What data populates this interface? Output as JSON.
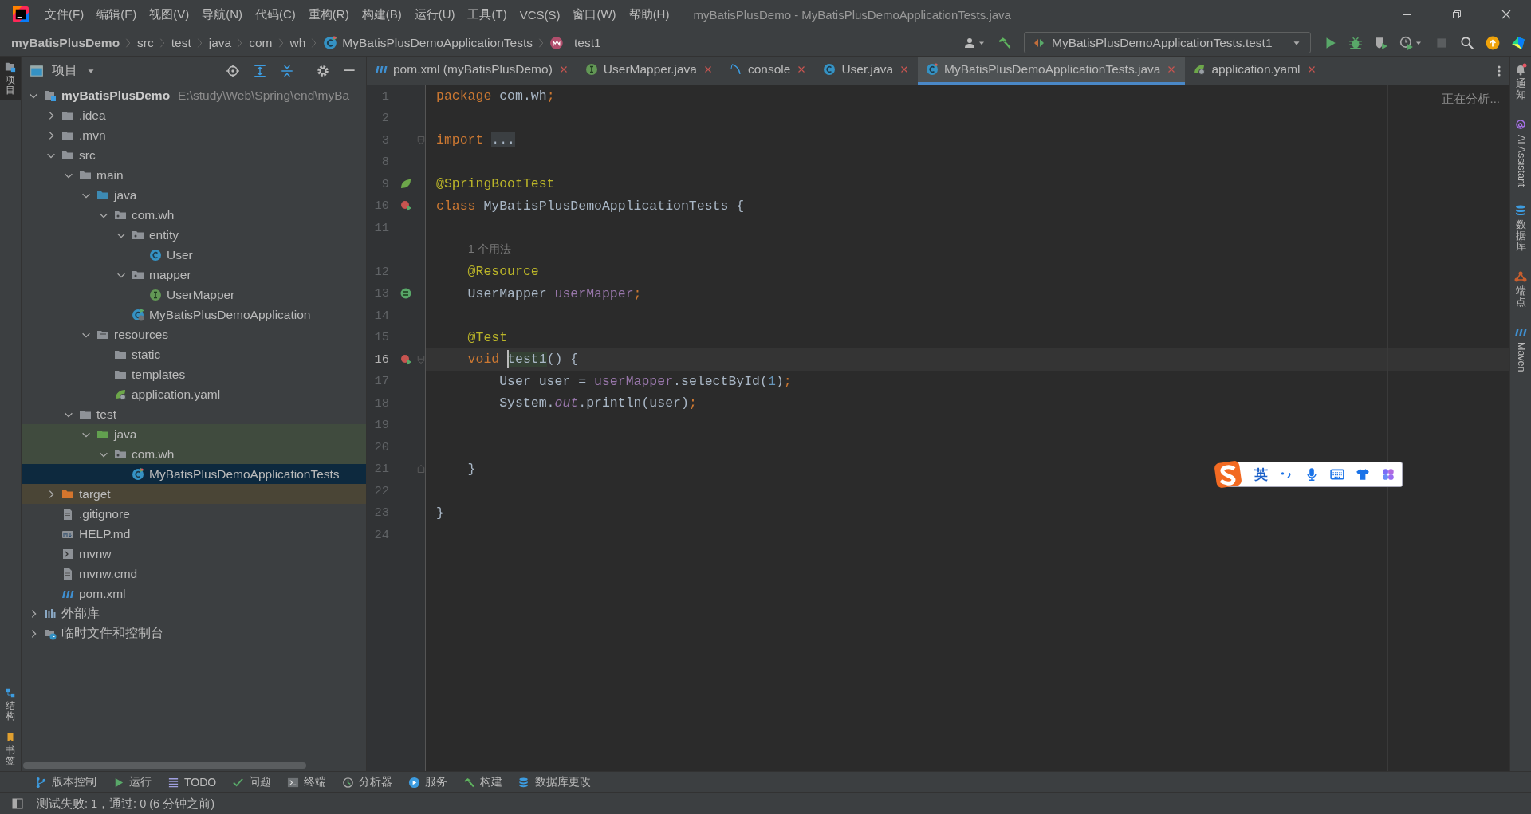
{
  "window": {
    "title": "myBatisPlusDemo - MyBatisPlusDemoApplicationTests.java"
  },
  "menu": [
    "文件(F)",
    "编辑(E)",
    "视图(V)",
    "导航(N)",
    "代码(C)",
    "重构(R)",
    "构建(B)",
    "运行(U)",
    "工具(T)",
    "VCS(S)",
    "窗口(W)",
    "帮助(H)"
  ],
  "breadcrumbs": [
    {
      "label": "myBatisPlusDemo",
      "kind": "project"
    },
    {
      "label": "src",
      "kind": "plain"
    },
    {
      "label": "test",
      "kind": "plain"
    },
    {
      "label": "java",
      "kind": "plain"
    },
    {
      "label": "com",
      "kind": "plain"
    },
    {
      "label": "wh",
      "kind": "plain"
    },
    {
      "label": "MyBatisPlusDemoApplicationTests",
      "kind": "test_class"
    },
    {
      "label": "test1",
      "kind": "method"
    }
  ],
  "run_config": {
    "label": "MyBatisPlusDemoApplicationTests.test1",
    "stop_disabled": true
  },
  "left_stripe": {
    "top": [
      {
        "label": "项目",
        "kind": "project",
        "selected": true
      }
    ],
    "bottom": [
      {
        "label": "结构",
        "kind": "structure",
        "selected": false
      },
      {
        "label": "书签",
        "kind": "bookmark",
        "selected": false
      }
    ]
  },
  "project_panel": {
    "title": "项目"
  },
  "tree": [
    {
      "label": "myBatisPlusDemo",
      "kind": "project",
      "hint": "E:\\study\\Web\\Spring\\end\\myBa",
      "expanded": true,
      "selected": false,
      "children": [
        {
          "label": ".idea",
          "kind": "folder",
          "expanded": false,
          "selected": false
        },
        {
          "label": ".mvn",
          "kind": "folder",
          "expanded": false,
          "selected": false
        },
        {
          "label": "src",
          "kind": "folder",
          "expanded": true,
          "selected": false,
          "children": [
            {
              "label": "main",
              "kind": "folder",
              "expanded": true,
              "selected": false,
              "children": [
                {
                  "label": "java",
                  "kind": "source_folder",
                  "expanded": true,
                  "selected": false,
                  "children": [
                    {
                      "label": "com.wh",
                      "kind": "package",
                      "expanded": true,
                      "selected": false,
                      "children": [
                        {
                          "label": "entity",
                          "kind": "package",
                          "expanded": true,
                          "selected": false,
                          "children": [
                            {
                              "label": "User",
                              "kind": "class",
                              "selected": false
                            }
                          ]
                        },
                        {
                          "label": "mapper",
                          "kind": "package",
                          "expanded": true,
                          "selected": false,
                          "children": [
                            {
                              "label": "UserMapper",
                              "kind": "interface",
                              "selected": false
                            }
                          ]
                        },
                        {
                          "label": "MyBatisPlusDemoApplication",
                          "kind": "spring_app",
                          "selected": false
                        }
                      ]
                    }
                  ]
                },
                {
                  "label": "resources",
                  "kind": "resources_folder",
                  "expanded": true,
                  "selected": false,
                  "children": [
                    {
                      "label": "static",
                      "kind": "folder",
                      "selected": false
                    },
                    {
                      "label": "templates",
                      "kind": "folder",
                      "selected": false
                    },
                    {
                      "label": "application.yaml",
                      "kind": "yaml",
                      "selected": false
                    }
                  ]
                }
              ]
            },
            {
              "label": "test",
              "kind": "folder",
              "expanded": true,
              "selected": false,
              "children": [
                {
                  "label": "java",
                  "kind": "test_folder",
                  "expanded": true,
                  "selected": false,
                  "tinted": true,
                  "children": [
                    {
                      "label": "com.wh",
                      "kind": "package",
                      "expanded": true,
                      "selected": false,
                      "tinted": true,
                      "children": [
                        {
                          "label": "MyBatisPlusDemoApplicationTests",
                          "kind": "test_class",
                          "selected": true
                        }
                      ]
                    }
                  ]
                }
              ]
            }
          ]
        },
        {
          "label": "target",
          "kind": "excluded_folder",
          "expanded": false,
          "selected": false,
          "tinted": true
        },
        {
          "label": ".gitignore",
          "kind": "file",
          "selected": false
        },
        {
          "label": "HELP.md",
          "kind": "markdown",
          "selected": false
        },
        {
          "label": "mvnw",
          "kind": "script",
          "selected": false
        },
        {
          "label": "mvnw.cmd",
          "kind": "file",
          "selected": false
        },
        {
          "label": "pom.xml",
          "kind": "maven",
          "selected": false
        }
      ]
    },
    {
      "label": "外部库",
      "kind": "library",
      "expanded": false,
      "selected": false
    },
    {
      "label": "临时文件和控制台",
      "kind": "scratch",
      "expanded": false,
      "selected": false
    }
  ],
  "tabs": [
    {
      "label": "pom.xml (myBatisPlusDemo)",
      "kind": "maven",
      "selected": false
    },
    {
      "label": "UserMapper.java",
      "kind": "interface",
      "selected": false
    },
    {
      "label": "console",
      "kind": "console",
      "selected": false
    },
    {
      "label": "User.java",
      "kind": "class",
      "selected": false
    },
    {
      "label": "MyBatisPlusDemoApplicationTests.java",
      "kind": "test_class",
      "selected": true
    },
    {
      "label": "application.yaml",
      "kind": "yaml",
      "selected": false
    }
  ],
  "editor": {
    "status": "正在分析...",
    "lines": [
      {
        "number": "1",
        "tokens": [
          {
            "kind": "keyword",
            "text": "package"
          },
          {
            "kind": "plain",
            "text": " com.wh"
          },
          {
            "kind": "keyword",
            "text": ";"
          }
        ]
      },
      {
        "number": "2"
      },
      {
        "number": "3",
        "fold": {
          "kind": "start"
        },
        "tokens": [
          {
            "kind": "keyword",
            "text": "import "
          },
          {
            "kind": "folded",
            "text": "..."
          }
        ]
      },
      {
        "number": "8"
      },
      {
        "number": "9",
        "gutter": {
          "kind": "spring"
        },
        "tokens": [
          {
            "kind": "annotation",
            "text": "@SpringBootTest"
          }
        ]
      },
      {
        "number": "10",
        "gutter": {
          "kind": "run"
        },
        "tokens": [
          {
            "kind": "keyword",
            "text": "class"
          },
          {
            "kind": "plain",
            "text": " MyBatisPlusDemoApplicationTests {"
          }
        ]
      },
      {
        "number": "11"
      },
      {
        "inlay": "1 个用法"
      },
      {
        "number": "12",
        "tokens": [
          {
            "kind": "annotation",
            "text": "    @Resource"
          }
        ]
      },
      {
        "number": "13",
        "gutter": {
          "kind": "bean"
        },
        "tokens": [
          {
            "kind": "plain",
            "text": "    UserMapper "
          },
          {
            "kind": "field",
            "text": "userMapper"
          },
          {
            "kind": "keyword",
            "text": ";"
          }
        ]
      },
      {
        "number": "14"
      },
      {
        "number": "15",
        "tokens": [
          {
            "kind": "annotation",
            "text": "    @Test"
          }
        ]
      },
      {
        "number": "16",
        "gutter": {
          "kind": "run"
        },
        "fold": {
          "kind": "start"
        },
        "current": true,
        "tokens": [
          {
            "kind": "keyword",
            "text": "    void "
          },
          {
            "kind": "highlight",
            "text": "test1",
            "caret": true
          },
          {
            "kind": "plain",
            "text": "() {"
          }
        ]
      },
      {
        "number": "17",
        "tokens": [
          {
            "kind": "plain",
            "text": "        User user = "
          },
          {
            "kind": "field",
            "text": "userMapper"
          },
          {
            "kind": "plain",
            "text": ".selectById("
          },
          {
            "kind": "number",
            "text": "1"
          },
          {
            "kind": "plain",
            "text": ")"
          },
          {
            "kind": "keyword",
            "text": ";"
          }
        ]
      },
      {
        "number": "18",
        "tokens": [
          {
            "kind": "plain",
            "text": "        System."
          },
          {
            "kind": "static",
            "text": "out"
          },
          {
            "kind": "plain",
            "text": ".println(user)"
          },
          {
            "kind": "keyword",
            "text": ";"
          }
        ]
      },
      {
        "number": "19"
      },
      {
        "number": "20"
      },
      {
        "number": "21",
        "fold": {
          "kind": "end"
        },
        "tokens": [
          {
            "kind": "plain",
            "text": "    }"
          }
        ]
      },
      {
        "number": "22"
      },
      {
        "number": "23",
        "tokens": [
          {
            "kind": "plain",
            "text": "}"
          }
        ]
      },
      {
        "number": "24"
      }
    ]
  },
  "right_stripe": [
    {
      "label": "通知",
      "kind": "bell"
    },
    {
      "label": "AI Assistant",
      "kind": "ai"
    },
    {
      "label": "数据库",
      "kind": "database"
    },
    {
      "label": "端点",
      "kind": "endpoints"
    },
    {
      "label": "Maven",
      "kind": "maven"
    }
  ],
  "ime_toolbar": {
    "label": "英"
  },
  "tool_windows": [
    {
      "label": "版本控制",
      "kind": "vcs"
    },
    {
      "label": "运行",
      "kind": "run"
    },
    {
      "label": "TODO",
      "kind": "todo"
    },
    {
      "label": "问题",
      "kind": "problems"
    },
    {
      "label": "终端",
      "kind": "terminal"
    },
    {
      "label": "分析器",
      "kind": "profiler"
    },
    {
      "label": "服务",
      "kind": "services"
    },
    {
      "label": "构建",
      "kind": "build"
    },
    {
      "label": "数据库更改",
      "kind": "db_changes"
    }
  ],
  "status_bar": {
    "message": "测试失败: 1，通过: 0 (6 分钟之前)"
  }
}
